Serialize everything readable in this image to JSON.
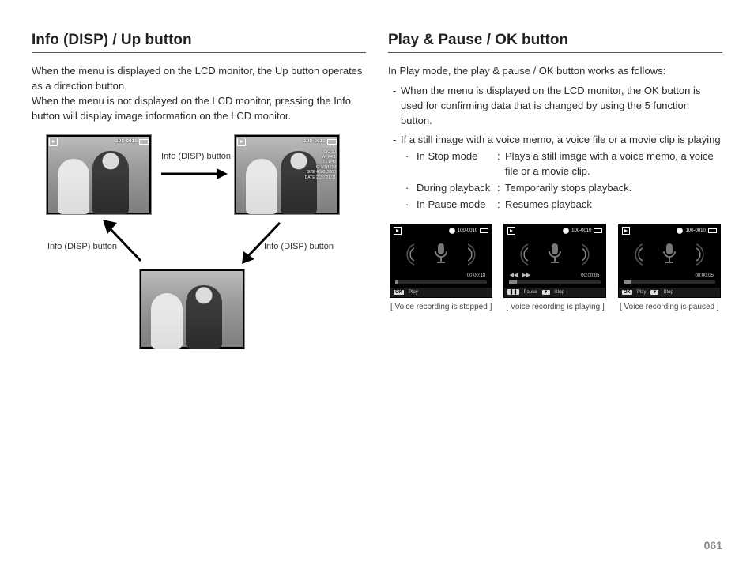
{
  "page_number": "061",
  "left": {
    "title": "Info (DISP) / Up button",
    "para": "When the menu is displayed on the LCD monitor, the Up button operates as a direction button.\nWhen the menu is not displayed on the LCD monitor, pressing the Info button will display image information on the LCD monitor.",
    "arrow_label": "Info (DISP) button",
    "thumb_counter": "100-0010",
    "info_overlay": "ISO 80\nAv F4.1\nTv 1/45\nFLASH ON\nSIZE 4000x3000\nDATE 2010.01.01"
  },
  "right": {
    "title": "Play & Pause / OK button",
    "intro": "In Play mode, the play & pause / OK button works as follows:",
    "b1": "When the menu is displayed on the LCD monitor, the OK button is used for confirming data that is changed by using the 5 function button.",
    "b2": "If a still image with a voice memo, a voice file or a movie clip is playing",
    "rows": [
      {
        "k": "In Stop mode",
        "v": "Plays a still image with a voice memo, a voice file or a movie clip."
      },
      {
        "k": "During playback",
        "v": "Temporarily stops playback."
      },
      {
        "k": "In Pause mode",
        "v": "Resumes playback"
      }
    ],
    "screens": [
      {
        "counter": "100-0010",
        "time": "00:00:18",
        "foot": [
          {
            "btn": "OK",
            "label": "Play"
          }
        ],
        "caption": "[ Voice recording is stopped ]",
        "fill": 3
      },
      {
        "counter": "100-0010",
        "time": "00:00:05",
        "foot": [
          {
            "btn": "❚❚",
            "label": "Pause"
          },
          {
            "btn": "▼",
            "label": "Stop"
          }
        ],
        "caption": "[ Voice recording is playing ]",
        "fill": 8,
        "rewind": true
      },
      {
        "counter": "100-0010",
        "time": "00:00:05",
        "foot": [
          {
            "btn": "OK",
            "label": "Play"
          },
          {
            "btn": "▼",
            "label": "Stop"
          }
        ],
        "caption": "[ Voice recording is paused ]",
        "fill": 8
      }
    ]
  }
}
